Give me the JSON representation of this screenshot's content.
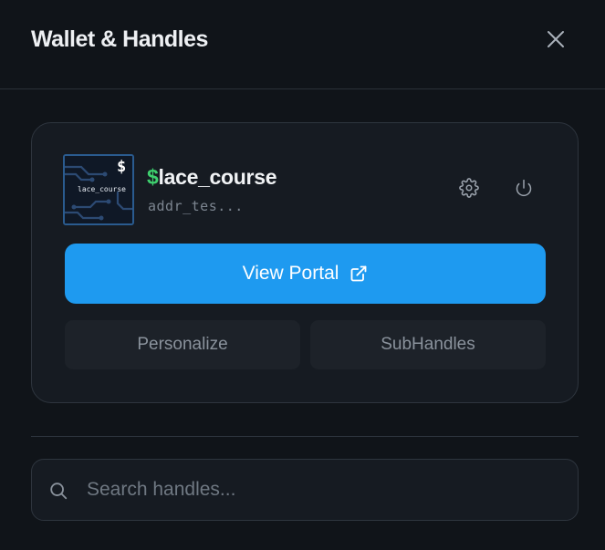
{
  "header": {
    "title": "Wallet & Handles",
    "close_icon": "close-icon"
  },
  "handle_card": {
    "avatar_label": "lace_course",
    "avatar_symbol": "$",
    "handle_prefix": "$",
    "handle_name": "lace_course",
    "address": "addr_tes...",
    "settings_icon": "gear-icon",
    "power_icon": "power-icon",
    "view_portal_label": "View Portal",
    "external_link_icon": "external-link-icon",
    "personalize_label": "Personalize",
    "subhandles_label": "SubHandles"
  },
  "search": {
    "placeholder": "Search handles...",
    "value": "",
    "icon": "search-icon"
  },
  "colors": {
    "background": "#101419",
    "card": "#161b22",
    "primary": "#1e9af0",
    "dollar_green": "#3ecf6e",
    "secondary_button": "#1d2229"
  }
}
